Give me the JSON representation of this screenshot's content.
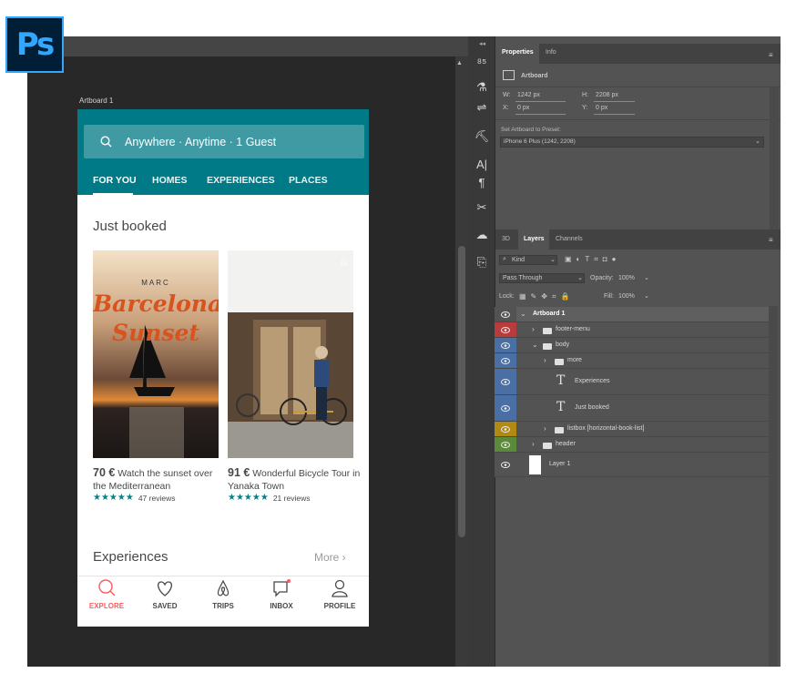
{
  "app": {
    "logo_text": "Ps"
  },
  "artboard": {
    "label": "Artboard 1",
    "search_text": "Anywhere · Anytime · 1 Guest",
    "tabs": [
      "FOR YOU",
      "HOMES",
      "EXPERIENCES",
      "PLACES"
    ],
    "section_title": "Just booked",
    "cards": [
      {
        "poster_top": "MARC",
        "poster_title_1": "Barcelona",
        "poster_title_2": "Sunset",
        "price": "70 €",
        "desc": "Watch the sunset over the Mediterranean",
        "stars": "★★★★★",
        "reviews": "47 reviews"
      },
      {
        "price": "91 €",
        "desc": "Wonderful Bicycle Tour in Yanaka Town",
        "stars": "★★★★★",
        "reviews": "21 reviews"
      }
    ],
    "experiences_title": "Experiences",
    "more_label": "More ›",
    "nav": [
      "EXPLORE",
      "SAVED",
      "TRIPS",
      "INBOX",
      "PROFILE"
    ]
  },
  "properties": {
    "tabs": [
      "Properties",
      "Info"
    ],
    "kind": "Artboard",
    "w_label": "W:",
    "w_value": "1242 px",
    "h_label": "H:",
    "h_value": "2208 px",
    "x_label": "X:",
    "x_value": "0 px",
    "y_label": "Y:",
    "y_value": "0 px",
    "preset_label": "Set Artboard to Preset:",
    "preset_value": "iPhone 6 Plus (1242, 2208)"
  },
  "layers_panel": {
    "tabs": [
      "3D",
      "Layers",
      "Channels"
    ],
    "filter": "Kind",
    "blend": "Pass Through",
    "opacity_label": "Opacity:",
    "opacity_value": "100%",
    "lock_label": "Lock:",
    "fill_label": "Fill:",
    "fill_value": "100%",
    "layers": [
      {
        "name": "Artboard 1",
        "color": "#535353"
      },
      {
        "name": "footer-menu",
        "color": "#b83c3c"
      },
      {
        "name": "body",
        "color": "#4a6fa5"
      },
      {
        "name": "more",
        "color": "#4a6fa5"
      },
      {
        "name": "Experiences",
        "color": "#4a6fa5"
      },
      {
        "name": "Just booked",
        "color": "#4a6fa5"
      },
      {
        "name": "listbox [horizontal-book-list]",
        "color": "#b08a14"
      },
      {
        "name": "header",
        "color": "#5b8a3a"
      },
      {
        "name": "Layer 1",
        "color": "#535353"
      }
    ]
  }
}
